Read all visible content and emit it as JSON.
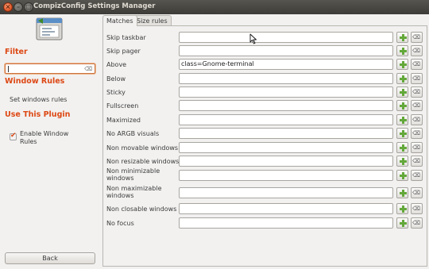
{
  "window": {
    "title": "CompizConfig Settings Manager",
    "close_glyph": "×",
    "minimize_glyph": "–",
    "maximize_glyph": "□"
  },
  "sidebar": {
    "filter_heading": "Filter",
    "filter_value": "",
    "filter_clear_glyph": "⌫",
    "window_rules_heading": "Window Rules",
    "settings_link": "Set windows rules",
    "use_plugin_heading": "Use This Plugin",
    "enable_label": "Enable Window Rules",
    "enable_checked": true,
    "enable_check_glyph": "✔",
    "back_label": "Back"
  },
  "tabs": [
    {
      "label": "Matches",
      "active": true
    },
    {
      "label": "Size rules",
      "active": false
    }
  ],
  "rules": [
    {
      "label": "Skip taskbar",
      "value": ""
    },
    {
      "label": "Skip pager",
      "value": ""
    },
    {
      "label": "Above",
      "value": "class=Gnome-terminal"
    },
    {
      "label": "Below",
      "value": ""
    },
    {
      "label": "Sticky",
      "value": ""
    },
    {
      "label": "Fullscreen",
      "value": ""
    },
    {
      "label": "Maximized",
      "value": ""
    },
    {
      "label": "No ARGB visuals",
      "value": ""
    },
    {
      "label": "Non movable windows",
      "value": ""
    },
    {
      "label": "Non resizable windows",
      "value": ""
    },
    {
      "label": "Non minimizable windows",
      "value": ""
    },
    {
      "label": "Non maximizable windows",
      "value": ""
    },
    {
      "label": "Non closable windows",
      "value": ""
    },
    {
      "label": "No focus",
      "value": ""
    }
  ],
  "row_buttons": {
    "clear_glyph": "⌫"
  },
  "colors": {
    "accent": "#dd4814",
    "add_icon": "#63a83a",
    "titlebar": "#3d3c38"
  }
}
